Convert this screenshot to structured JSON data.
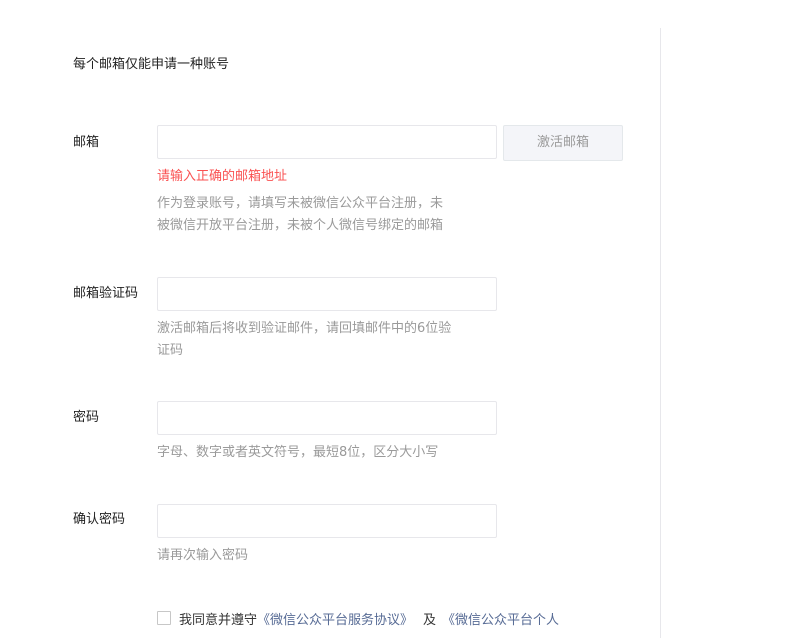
{
  "intro": "每个邮箱仅能申请一种账号",
  "email": {
    "label": "邮箱",
    "value": "",
    "placeholder": "",
    "activate_button": "激活邮箱",
    "error": "请输入正确的邮箱地址",
    "tip": "作为登录账号，请填写未被微信公众平台注册，未\n被微信开放平台注册，未被个人微信号绑定的邮箱"
  },
  "code": {
    "label": "邮箱验证码",
    "value": "",
    "placeholder": "",
    "tip": "激活邮箱后将收到验证邮件，请回填邮件中的6位验\n证码"
  },
  "password": {
    "label": "密码",
    "value": "",
    "placeholder": "",
    "tip": "字母、数字或者英文符号，最短8位，区分大小写"
  },
  "confirm": {
    "label": "确认密码",
    "value": "",
    "placeholder": "",
    "tip": "请再次输入密码"
  },
  "agreement": {
    "checked": false,
    "prefix": "我同意并遵守",
    "link1": "《微信公众平台服务协议》",
    "and": "及",
    "link2": "《微信公众平台个人"
  },
  "colors": {
    "error": "#fa5151",
    "link": "#576b95",
    "tip": "#9a9a9a"
  }
}
